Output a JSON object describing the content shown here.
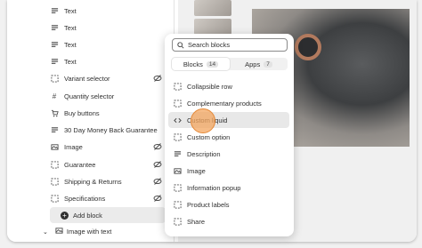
{
  "sidebar": {
    "items": [
      {
        "label": "Text",
        "icon": "text-lines-icon",
        "eye": false
      },
      {
        "label": "Text",
        "icon": "text-lines-icon",
        "eye": false
      },
      {
        "label": "Text",
        "icon": "text-lines-icon",
        "eye": false
      },
      {
        "label": "Text",
        "icon": "text-lines-icon",
        "eye": false
      },
      {
        "label": "Variant selector",
        "icon": "dashed-square-icon",
        "eye": true
      },
      {
        "label": "Quantity selector",
        "icon": "hash-icon",
        "eye": false
      },
      {
        "label": "Buy buttons",
        "icon": "cart-icon",
        "eye": false
      },
      {
        "label": "30 Day Money Back Guarantee",
        "icon": "text-lines-icon",
        "eye": false
      },
      {
        "label": "Image",
        "icon": "image-icon",
        "eye": true
      },
      {
        "label": "Guarantee",
        "icon": "dashed-square-icon",
        "eye": true
      },
      {
        "label": "Shipping & Returns",
        "icon": "dashed-square-icon",
        "eye": true
      },
      {
        "label": "Specifications",
        "icon": "dashed-square-icon",
        "eye": true
      }
    ],
    "add_block_label": "Add block",
    "section_label": "Image with text"
  },
  "popup": {
    "search_placeholder": "Search blocks",
    "tabs": [
      {
        "label": "Blocks",
        "count": "14"
      },
      {
        "label": "Apps",
        "count": "7"
      }
    ],
    "options": [
      {
        "label": "Collapsible row",
        "icon": "dashed-square-icon"
      },
      {
        "label": "Complementary products",
        "icon": "dashed-square-icon"
      },
      {
        "label": "Custom liquid",
        "icon": "code-icon"
      },
      {
        "label": "Custom option",
        "icon": "dashed-square-icon"
      },
      {
        "label": "Description",
        "icon": "text-lines-icon"
      },
      {
        "label": "Image",
        "icon": "image-icon"
      },
      {
        "label": "Information popup",
        "icon": "dashed-square-icon"
      },
      {
        "label": "Product labels",
        "icon": "dashed-square-icon"
      },
      {
        "label": "Share",
        "icon": "dashed-square-icon"
      }
    ]
  },
  "colors": {
    "hover_row": "#e8e8e8",
    "cursor_highlight": "#f3a65f"
  }
}
